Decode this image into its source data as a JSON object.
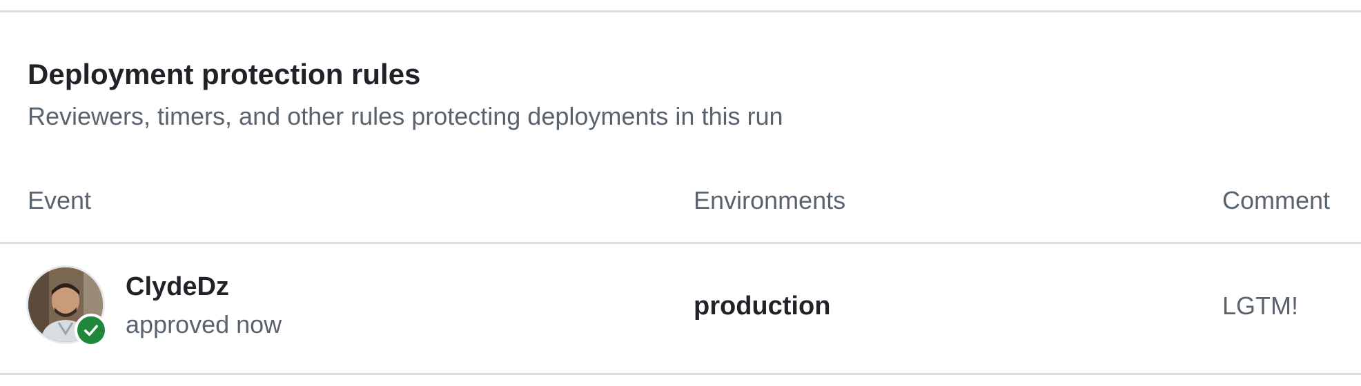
{
  "section": {
    "title": "Deployment protection rules",
    "subtitle": "Reviewers, timers, and other rules protecting deployments in this run"
  },
  "table": {
    "headers": {
      "event": "Event",
      "environments": "Environments",
      "comment": "Comment"
    },
    "rows": [
      {
        "user": "ClydeDz",
        "status": "approved now",
        "environment": "production",
        "comment": "LGTM!",
        "avatar_icon": "user-avatar",
        "badge_icon": "check-circle-icon",
        "badge_color": "#1f883d"
      }
    ]
  }
}
